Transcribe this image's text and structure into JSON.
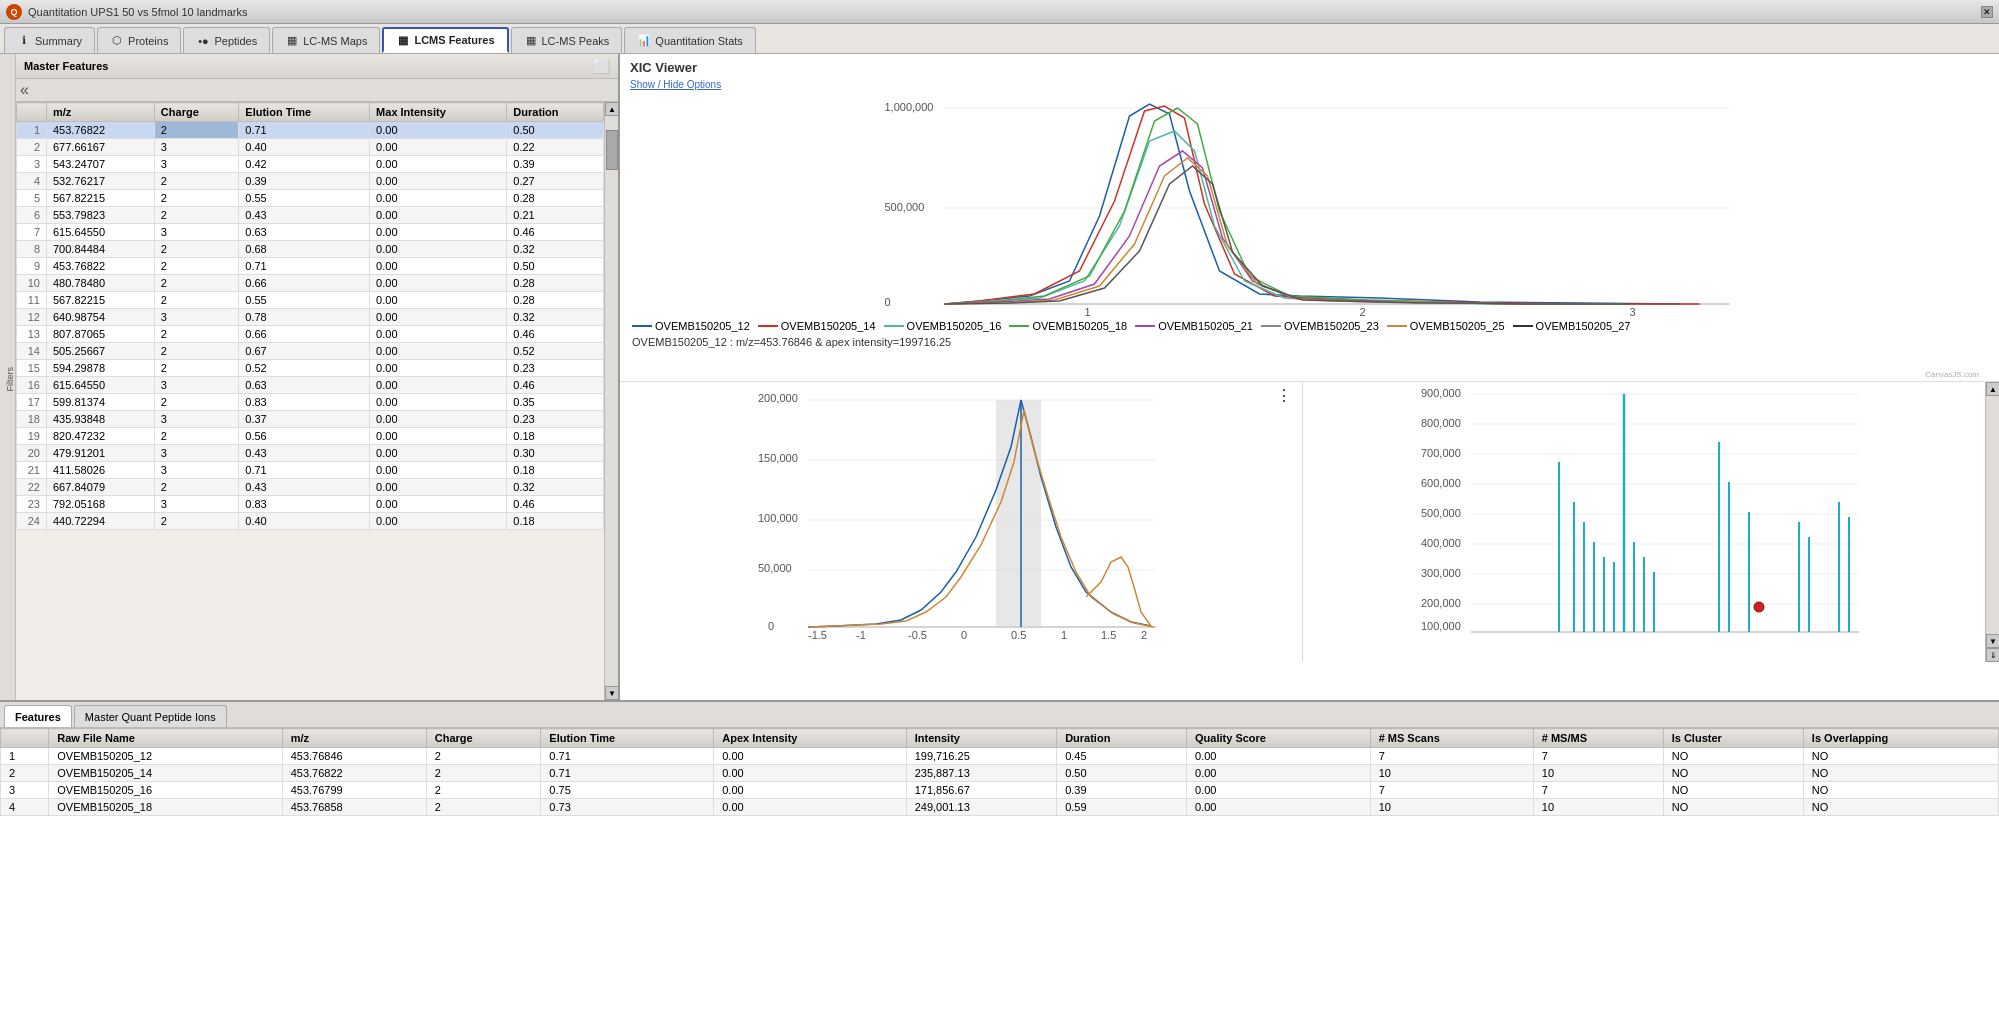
{
  "window": {
    "title": "Quantitation UPS1 50 vs 5fmol 10 landmarks"
  },
  "tabs": [
    {
      "label": "Summary",
      "icon": "info",
      "active": false
    },
    {
      "label": "Proteins",
      "icon": "protein",
      "active": false
    },
    {
      "label": "Peptides",
      "icon": "peptide",
      "active": false
    },
    {
      "label": "LC-MS Maps",
      "icon": "map",
      "active": false
    },
    {
      "label": "LCMS Features",
      "icon": "feature",
      "active": true
    },
    {
      "label": "LC-MS Peaks",
      "icon": "peak",
      "active": false
    },
    {
      "label": "Quantitation Stats",
      "icon": "stats",
      "active": false
    }
  ],
  "masterFeatures": {
    "title": "Master Features",
    "columns": [
      "",
      "m/z",
      "Charge",
      "Elution Time",
      "Max Intensity",
      "Duration"
    ],
    "rows": [
      [
        1,
        "453.76822",
        2,
        "0.71",
        "0.00",
        "0.50"
      ],
      [
        2,
        "677.66167",
        3,
        "0.40",
        "0.00",
        "0.22"
      ],
      [
        3,
        "543.24707",
        3,
        "0.42",
        "0.00",
        "0.39"
      ],
      [
        4,
        "532.76217",
        2,
        "0.39",
        "0.00",
        "0.27"
      ],
      [
        5,
        "567.82215",
        2,
        "0.55",
        "0.00",
        "0.28"
      ],
      [
        6,
        "553.79823",
        2,
        "0.43",
        "0.00",
        "0.21"
      ],
      [
        7,
        "615.64550",
        3,
        "0.63",
        "0.00",
        "0.46"
      ],
      [
        8,
        "700.84484",
        2,
        "0.68",
        "0.00",
        "0.32"
      ],
      [
        9,
        "453.76822",
        2,
        "0.71",
        "0.00",
        "0.50"
      ],
      [
        10,
        "480.78480",
        2,
        "0.66",
        "0.00",
        "0.28"
      ],
      [
        11,
        "567.82215",
        2,
        "0.55",
        "0.00",
        "0.28"
      ],
      [
        12,
        "640.98754",
        3,
        "0.78",
        "0.00",
        "0.32"
      ],
      [
        13,
        "807.87065",
        2,
        "0.66",
        "0.00",
        "0.46"
      ],
      [
        14,
        "505.25667",
        2,
        "0.67",
        "0.00",
        "0.52"
      ],
      [
        15,
        "594.29878",
        2,
        "0.52",
        "0.00",
        "0.23"
      ],
      [
        16,
        "615.64550",
        3,
        "0.63",
        "0.00",
        "0.46"
      ],
      [
        17,
        "599.81374",
        2,
        "0.83",
        "0.00",
        "0.35"
      ],
      [
        18,
        "435.93848",
        3,
        "0.37",
        "0.00",
        "0.23"
      ],
      [
        19,
        "820.47232",
        2,
        "0.56",
        "0.00",
        "0.18"
      ],
      [
        20,
        "479.91201",
        3,
        "0.43",
        "0.00",
        "0.30"
      ],
      [
        21,
        "411.58026",
        3,
        "0.71",
        "0.00",
        "0.18"
      ],
      [
        22,
        "667.84079",
        2,
        "0.43",
        "0.00",
        "0.32"
      ],
      [
        23,
        "792.05168",
        3,
        "0.83",
        "0.00",
        "0.46"
      ],
      [
        24,
        "440.72294",
        2,
        "0.40",
        "0.00",
        "0.18"
      ]
    ]
  },
  "xicViewer": {
    "title": "XIC Viewer",
    "showHideOptions": "Show / Hide Options",
    "legend": [
      {
        "label": "OVEMB150205_12",
        "color": "#1a5fa8"
      },
      {
        "label": "OVEMB150205_14",
        "color": "#cc3322"
      },
      {
        "label": "OVEMB150205_16",
        "color": "#4db8a8"
      },
      {
        "label": "OVEMB150205_18",
        "color": "#44aa44"
      },
      {
        "label": "OVEMB150205_21",
        "color": "#aa44aa"
      },
      {
        "label": "OVEMB150205_23",
        "color": "#888888"
      },
      {
        "label": "OVEMB150205_25",
        "color": "#cc8833"
      },
      {
        "label": "OVEMB150205_27",
        "color": "#333333"
      }
    ],
    "chartInfo": "OVEMB150205_12 : m/z=453.76846 & apex intensity=199716.25",
    "canvasJs": "CanvasJS.com"
  },
  "bottomPanel": {
    "tabs": [
      "Features",
      "Master Quant Peptide Ions"
    ],
    "activeTab": "Features",
    "columns": [
      "",
      "Raw File Name",
      "m/z",
      "Charge",
      "Elution Time",
      "Apex Intensity",
      "Intensity",
      "Duration",
      "Quality Score",
      "# MS Scans",
      "# MS/MS",
      "Is Cluster",
      "Is Overlapping"
    ],
    "rows": [
      [
        1,
        "OVEMB150205_12",
        "453.76846",
        2,
        "0.71",
        "0.00",
        "199,716.25",
        "0.45",
        "0.00",
        7,
        7,
        "NO",
        "NO"
      ],
      [
        2,
        "OVEMB150205_14",
        "453.76822",
        2,
        "0.71",
        "0.00",
        "235,887.13",
        "0.50",
        "0.00",
        10,
        10,
        "NO",
        "NO"
      ],
      [
        3,
        "OVEMB150205_16",
        "453.76799",
        2,
        "0.75",
        "0.00",
        "171,856.67",
        "0.39",
        "0.00",
        7,
        7,
        "NO",
        "NO"
      ],
      [
        4,
        "OVEMB150205_18",
        "453.76858",
        2,
        "0.73",
        "0.00",
        "249,001.13",
        "0.59",
        "0.00",
        10,
        10,
        "NO",
        "NO"
      ]
    ]
  }
}
